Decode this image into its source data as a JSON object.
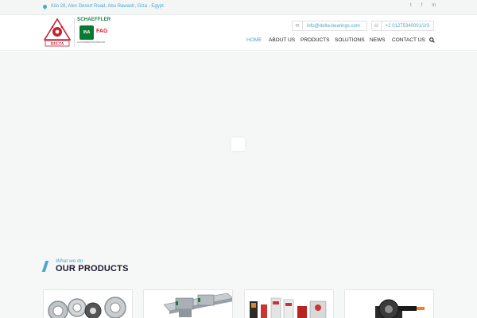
{
  "topbar": {
    "address": "Kilo 28, Alex Desert Road, Abu Rawash, Giza - Egypt",
    "social": [
      {
        "icon": "twitter-icon",
        "glyph": "t"
      },
      {
        "icon": "facebook-icon",
        "glyph": "f"
      },
      {
        "icon": "linkedin-icon",
        "glyph": "in"
      }
    ]
  },
  "header": {
    "logo_delta_text": "DELTA",
    "logo_schaeffler": {
      "brand": "SCHAEFFLER",
      "ina": "INA",
      "fag": "FAG",
      "tagline": "AUTHORIZED DISTRIBUTOR"
    },
    "email": "info@delta-bearings.com",
    "phone": "+2 01275340001/2/3",
    "email_icon": "envelope-icon",
    "phone_icon": "phone-icon"
  },
  "nav": {
    "items": [
      "HOME",
      "ABOUT US",
      "PRODUCTS",
      "SOLUTIONS",
      "NEWS",
      "CONTACT US"
    ],
    "active": "HOME",
    "search_icon": "search-icon"
  },
  "section": {
    "subtitle": "What we do",
    "title": "OUR PRODUCTS"
  },
  "colors": {
    "accent": "#4aa8d0",
    "heading": "#1a1a2e",
    "schaeffler_green": "#13803a",
    "fag_red": "#d9232e",
    "delta_red": "#c8202e"
  }
}
